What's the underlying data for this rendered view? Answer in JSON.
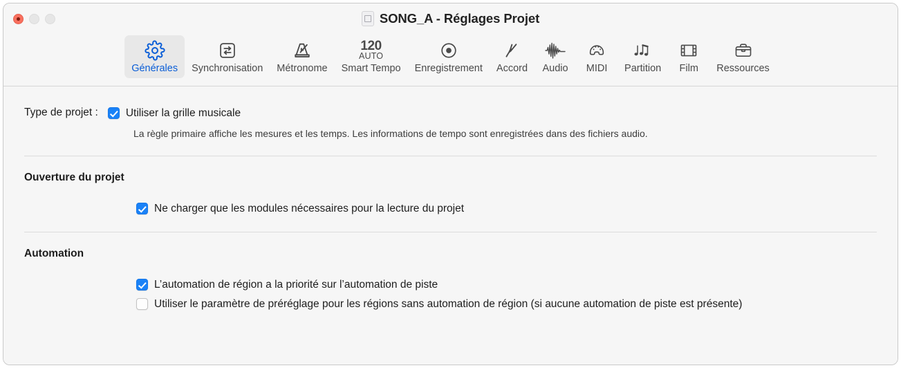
{
  "window": {
    "title": "SONG_A - Réglages Projet",
    "doc_icon": "document-icon",
    "controls": {
      "close": "close-button",
      "minimize": "minimize-button",
      "zoom": "zoom-button"
    }
  },
  "toolbar": {
    "selected": "Générales",
    "accent_color": "#0b5ed7",
    "tabs": [
      {
        "label": "Générales",
        "icon": "gear-icon",
        "selected": true
      },
      {
        "label": "Synchronisation",
        "icon": "sync-arrows-icon",
        "selected": false
      },
      {
        "label": "Métronome",
        "icon": "metronome-icon",
        "selected": false
      },
      {
        "label": "Smart Tempo",
        "icon": "tempo-icon",
        "tempo_value": "120",
        "tempo_mode": "AUTO",
        "selected": false
      },
      {
        "label": "Enregistrement",
        "icon": "record-circle-icon",
        "selected": false
      },
      {
        "label": "Accord",
        "icon": "tuning-fork-icon",
        "selected": false
      },
      {
        "label": "Audio",
        "icon": "waveform-icon",
        "selected": false
      },
      {
        "label": "MIDI",
        "icon": "midi-connector-icon",
        "selected": false
      },
      {
        "label": "Partition",
        "icon": "music-notes-icon",
        "selected": false
      },
      {
        "label": "Film",
        "icon": "filmstrip-icon",
        "selected": false
      },
      {
        "label": "Ressources",
        "icon": "briefcase-icon",
        "selected": false
      }
    ]
  },
  "content": {
    "project_type": {
      "label": "Type de projet :",
      "checkbox_label": "Utiliser la grille musicale",
      "checked": true,
      "hint": "La règle primaire affiche les mesures et les temps. Les informations de tempo sont enregistrées dans des fichiers audio."
    },
    "project_open": {
      "title": "Ouverture du projet",
      "checkbox_label": "Ne charger que les modules nécessaires pour la lecture du projet",
      "checked": true
    },
    "automation": {
      "title": "Automation",
      "option1_label": "L’automation de région a la priorité sur l’automation de piste",
      "option1_checked": true,
      "option2_label": "Utiliser le paramètre de préréglage pour les régions sans automation de région (si aucune automation de piste est présente)",
      "option2_checked": false
    }
  }
}
